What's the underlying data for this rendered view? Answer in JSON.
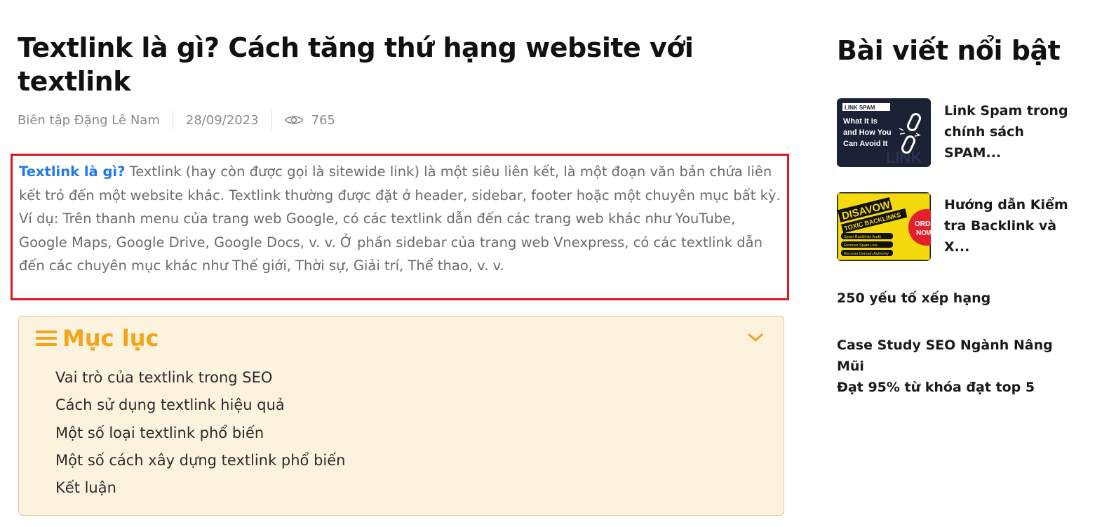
{
  "article": {
    "title": "Textlink là gì? Cách tăng thứ hạng website với textlink",
    "author": "Biên tập Đặng Lê Nam",
    "date": "28/09/2023",
    "views": "765",
    "intro_lead": "Textlink là gì?",
    "intro_body": " Textlink (hay còn được gọi là sitewide link) là một siêu liên kết, là một đoạn văn bản chứa liên kết trỏ đến một website khác. Textlink thường được đặt ở header, sidebar, footer hoặc một chuyên mục bất kỳ. Ví dụ: Trên thanh menu của trang web Google, có các textlink dẫn đến các trang web khác như YouTube, Google Maps, Google Drive, Google Docs, v. v. Ở phần sidebar của trang web Vnexpress, có các textlink dẫn đến các chuyên mục khác như Thế giới, Thời sự, Giải trí, Thể thao, v. v."
  },
  "toc": {
    "title": "Mục lục",
    "items": [
      "Vai trò của textlink trong SEO",
      "Cách sử dụng textlink hiệu quả",
      "Một số loại textlink phổ biến",
      "Một số cách xây dựng textlink phổ biến",
      "Kết luận"
    ]
  },
  "sidebar": {
    "title": "Bài viết nổi bật",
    "posts": [
      {
        "title": "Link Spam trong chính sách SPAM...",
        "thumb": {
          "tag": "LINK SPAM",
          "l1": "What It Is",
          "l2": "and How You",
          "l3": "Can Avoid It",
          "bg": "#1b2235",
          "icon": "broken-chain-icon"
        }
      },
      {
        "title": "Hướng dẫn Kiểm tra Backlink và X...",
        "thumb": {
          "l1": "DISAVOW",
          "l2": "TOXIC BACKLINKS",
          "b1": "Spam Backlinks Audit",
          "b2": "Remove Spam Link",
          "b3": "Recover Domain Authority",
          "badge1": "ORDER",
          "badge2": "NOW",
          "bg": "#f5d90f"
        }
      },
      {
        "title": "250 yếu tố xếp hạng"
      },
      {
        "title_l1": "Case Study SEO Ngành Nâng Mũi",
        "title_l2": "Đạt 95% từ khóa đạt top 5"
      }
    ]
  },
  "colors": {
    "accent": "#f0a51a",
    "link": "#1f7ae8",
    "highlight_border": "#e3141c",
    "toc_bg": "#fdf2dd"
  }
}
